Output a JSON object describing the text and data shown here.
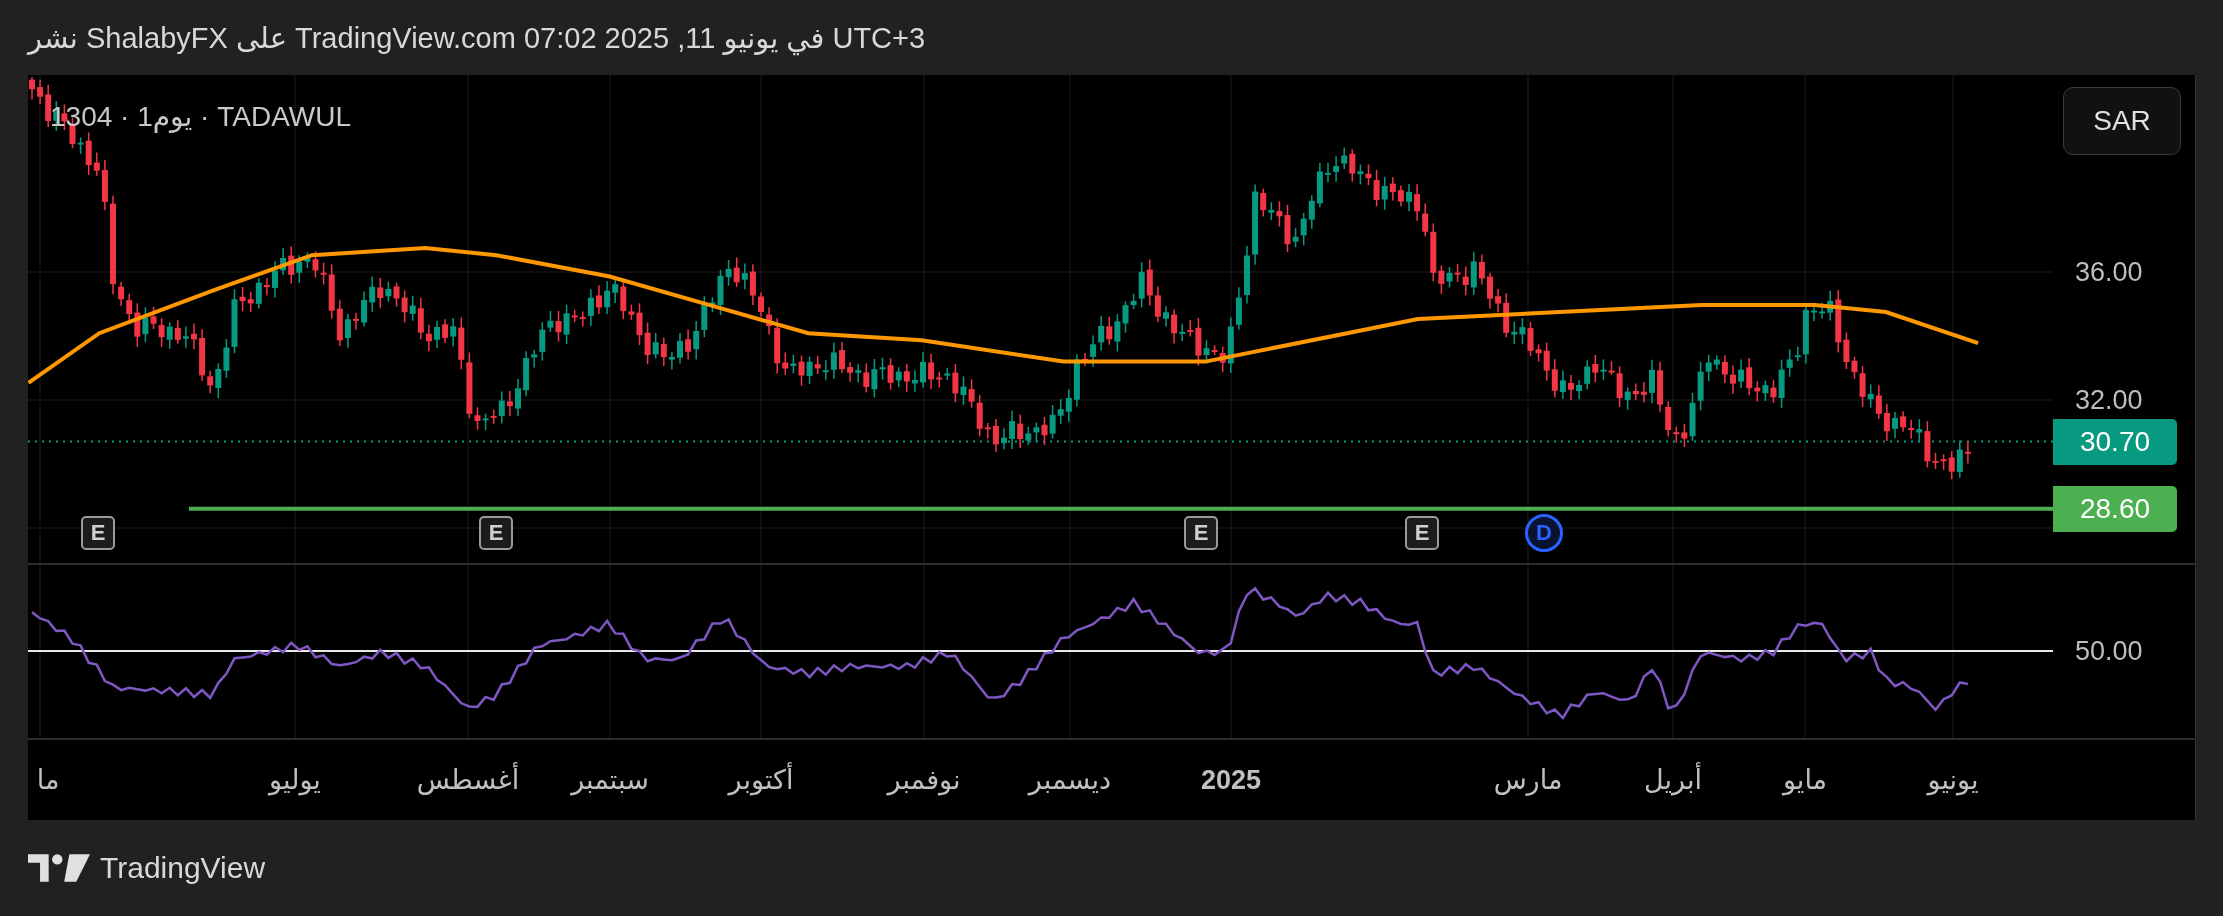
{
  "header": {
    "text": "نشر ShalabyFX على TradingView.com في يونيو 11, 2025 07:02 UTC+3"
  },
  "chart": {
    "symbol_legend": "1304 · 1يوم · TADAWUL",
    "currency_button": "SAR",
    "price_axis": [
      {
        "label": "36.00"
      },
      {
        "label": "32.00"
      }
    ],
    "price_labels": [
      {
        "label": "30.70",
        "color": "#089981"
      },
      {
        "label": "28.60",
        "color": "#4caf50"
      }
    ],
    "events": [
      {
        "kind": "dividend",
        "label": "D"
      },
      {
        "kind": "earnings",
        "label": "E"
      },
      {
        "kind": "earnings",
        "label": "E"
      },
      {
        "kind": "earnings",
        "label": "E"
      },
      {
        "kind": "earnings",
        "label": "E"
      }
    ],
    "rsi_axis": [
      {
        "label": "50.00"
      }
    ],
    "time_axis": [
      {
        "label": "يونيو",
        "bold": false
      },
      {
        "label": "مايو",
        "bold": false
      },
      {
        "label": "أبريل",
        "bold": false
      },
      {
        "label": "مارس",
        "bold": false
      },
      {
        "label": "2025",
        "bold": true
      },
      {
        "label": "ديسمبر",
        "bold": false
      },
      {
        "label": "نوفمبر",
        "bold": false
      },
      {
        "label": "أكتوبر",
        "bold": false
      },
      {
        "label": "سبتمبر",
        "bold": false
      },
      {
        "label": "أغسطس",
        "bold": false
      },
      {
        "label": "يوليو",
        "bold": false
      },
      {
        "label": "ما",
        "bold": false
      }
    ]
  },
  "footer": {
    "brand": "TradingView"
  }
}
